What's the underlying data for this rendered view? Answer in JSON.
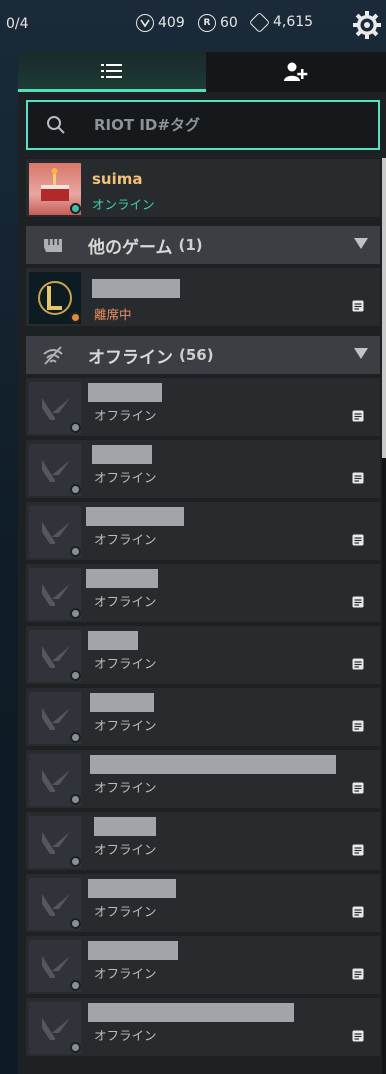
{
  "topbar": {
    "party_slots": "0/4",
    "currencies": [
      {
        "icon": "valorant-points-icon",
        "glyph": "V",
        "value": "409"
      },
      {
        "icon": "radianite-icon",
        "glyph": "R",
        "value": "60"
      },
      {
        "icon": "kingdom-credits-icon",
        "glyph": "K",
        "value": "4,615"
      }
    ]
  },
  "tabs": [
    {
      "name": "friends-list-tab",
      "icon": "list-icon"
    },
    {
      "name": "add-friend-tab",
      "icon": "add-friend-icon"
    }
  ],
  "search": {
    "placeholder": "RIOT ID#タグ"
  },
  "self": {
    "name": "suima",
    "status": "オンライン"
  },
  "groups": {
    "other_games": {
      "title": "他のゲーム",
      "count": "(1)"
    },
    "offline": {
      "title": "オフライン",
      "count": "(56)"
    }
  },
  "other_game_friend": {
    "status": "離席中",
    "game": "League of Legends"
  },
  "offline_friends": [
    {
      "status": "オフライン",
      "redact_w": 74
    },
    {
      "status": "オフライン",
      "redact_w": 60
    },
    {
      "status": "オフライン",
      "redact_w": 98
    },
    {
      "status": "オフライン",
      "redact_w": 72
    },
    {
      "status": "オフライン",
      "redact_w": 50
    },
    {
      "status": "オフライン",
      "redact_w": 64
    },
    {
      "status": "オフライン",
      "redact_w": 246
    },
    {
      "status": "オフライン",
      "redact_w": 62
    },
    {
      "status": "オフライン",
      "redact_w": 88
    },
    {
      "status": "オフライン",
      "redact_w": 90
    },
    {
      "status": "オフライン",
      "redact_w": 206
    }
  ],
  "colors": {
    "accent": "#56e3c3",
    "online": "#3fcfb3",
    "away": "#e89060",
    "self_name": "#f0c27a"
  }
}
